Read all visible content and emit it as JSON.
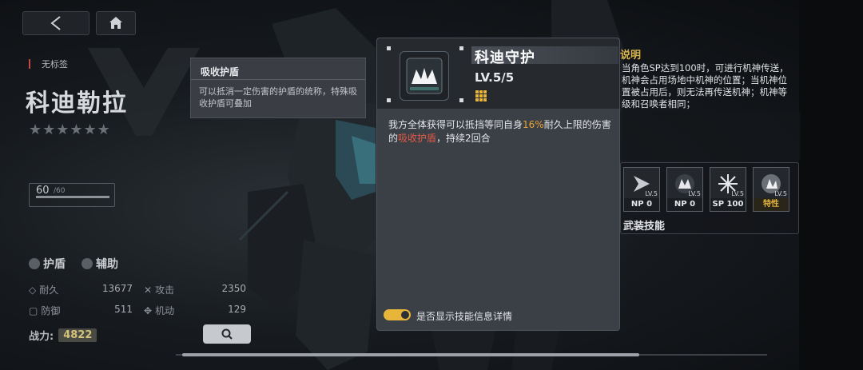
{
  "nav": {
    "back_icon": "back-arrow-icon",
    "home_icon": "home-icon"
  },
  "character": {
    "tag": "无标签",
    "name": "科迪勒拉",
    "stars": "★★★★★★",
    "level": {
      "current": "60",
      "max": "/60",
      "exp_fraction": 1.0
    },
    "traits": [
      "护盾",
      "辅助"
    ],
    "stats": [
      {
        "label": "耐久",
        "value": "13677"
      },
      {
        "label": "攻击",
        "value": "2350"
      },
      {
        "label": "防御",
        "value": "511"
      },
      {
        "label": "机动",
        "value": "129"
      }
    ],
    "power_label": "战力:",
    "power_value": "4822"
  },
  "right_panel": {
    "desc_title": "说明",
    "desc_text": "当角色SP达到100时，可进行机神传送，机神会占用场地中机神的位置；当机神位置被占用后，则无法再传送机神；机神等级和召唤者相同；",
    "skills": [
      {
        "lv": "LV.5",
        "cost": "NP 0"
      },
      {
        "lv": "LV.5",
        "cost": "NP 0"
      },
      {
        "lv": "LV.5",
        "cost": "SP 100"
      },
      {
        "lv": "LV.5",
        "cost": "特性"
      }
    ],
    "armed_label": "武装技能"
  },
  "tooltip": {
    "title": "吸收护盾",
    "body": "可以抵消一定伤害的护盾的统称，特殊吸收护盾可叠加"
  },
  "popup": {
    "name": "科迪守护",
    "level": "LV.5/5",
    "desc_part1": "我方全体获得可以抵挡等同自身",
    "desc_percent": "16%",
    "desc_part2": "耐久上限的伤害的",
    "desc_keyword": "吸收护盾",
    "desc_part3": "，持续2回合",
    "toggle_label": "是否显示技能信息详情",
    "toggle_on": true
  },
  "colors": {
    "accent_gold": "#e6b53a",
    "highlight_red": "#e05b45",
    "highlight_gold": "#e8a33a"
  }
}
